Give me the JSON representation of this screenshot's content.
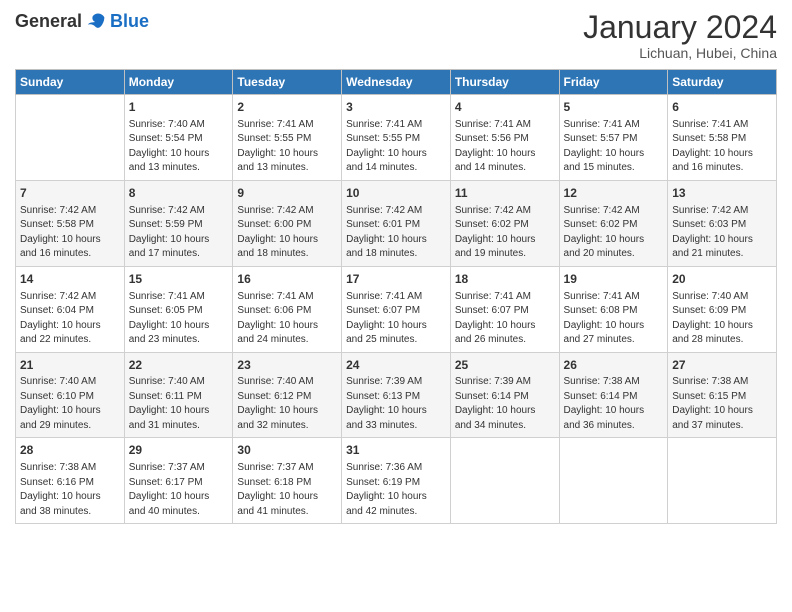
{
  "header": {
    "logo_general": "General",
    "logo_blue": "Blue",
    "title": "January 2024",
    "subtitle": "Lichuan, Hubei, China"
  },
  "days_of_week": [
    "Sunday",
    "Monday",
    "Tuesday",
    "Wednesday",
    "Thursday",
    "Friday",
    "Saturday"
  ],
  "weeks": [
    [
      {
        "day": "",
        "sunrise": "",
        "sunset": "",
        "daylight": ""
      },
      {
        "day": "1",
        "sunrise": "Sunrise: 7:40 AM",
        "sunset": "Sunset: 5:54 PM",
        "daylight": "Daylight: 10 hours and 13 minutes."
      },
      {
        "day": "2",
        "sunrise": "Sunrise: 7:41 AM",
        "sunset": "Sunset: 5:55 PM",
        "daylight": "Daylight: 10 hours and 13 minutes."
      },
      {
        "day": "3",
        "sunrise": "Sunrise: 7:41 AM",
        "sunset": "Sunset: 5:55 PM",
        "daylight": "Daylight: 10 hours and 14 minutes."
      },
      {
        "day": "4",
        "sunrise": "Sunrise: 7:41 AM",
        "sunset": "Sunset: 5:56 PM",
        "daylight": "Daylight: 10 hours and 14 minutes."
      },
      {
        "day": "5",
        "sunrise": "Sunrise: 7:41 AM",
        "sunset": "Sunset: 5:57 PM",
        "daylight": "Daylight: 10 hours and 15 minutes."
      },
      {
        "day": "6",
        "sunrise": "Sunrise: 7:41 AM",
        "sunset": "Sunset: 5:58 PM",
        "daylight": "Daylight: 10 hours and 16 minutes."
      }
    ],
    [
      {
        "day": "7",
        "sunrise": "Sunrise: 7:42 AM",
        "sunset": "Sunset: 5:58 PM",
        "daylight": "Daylight: 10 hours and 16 minutes."
      },
      {
        "day": "8",
        "sunrise": "Sunrise: 7:42 AM",
        "sunset": "Sunset: 5:59 PM",
        "daylight": "Daylight: 10 hours and 17 minutes."
      },
      {
        "day": "9",
        "sunrise": "Sunrise: 7:42 AM",
        "sunset": "Sunset: 6:00 PM",
        "daylight": "Daylight: 10 hours and 18 minutes."
      },
      {
        "day": "10",
        "sunrise": "Sunrise: 7:42 AM",
        "sunset": "Sunset: 6:01 PM",
        "daylight": "Daylight: 10 hours and 18 minutes."
      },
      {
        "day": "11",
        "sunrise": "Sunrise: 7:42 AM",
        "sunset": "Sunset: 6:02 PM",
        "daylight": "Daylight: 10 hours and 19 minutes."
      },
      {
        "day": "12",
        "sunrise": "Sunrise: 7:42 AM",
        "sunset": "Sunset: 6:02 PM",
        "daylight": "Daylight: 10 hours and 20 minutes."
      },
      {
        "day": "13",
        "sunrise": "Sunrise: 7:42 AM",
        "sunset": "Sunset: 6:03 PM",
        "daylight": "Daylight: 10 hours and 21 minutes."
      }
    ],
    [
      {
        "day": "14",
        "sunrise": "Sunrise: 7:42 AM",
        "sunset": "Sunset: 6:04 PM",
        "daylight": "Daylight: 10 hours and 22 minutes."
      },
      {
        "day": "15",
        "sunrise": "Sunrise: 7:41 AM",
        "sunset": "Sunset: 6:05 PM",
        "daylight": "Daylight: 10 hours and 23 minutes."
      },
      {
        "day": "16",
        "sunrise": "Sunrise: 7:41 AM",
        "sunset": "Sunset: 6:06 PM",
        "daylight": "Daylight: 10 hours and 24 minutes."
      },
      {
        "day": "17",
        "sunrise": "Sunrise: 7:41 AM",
        "sunset": "Sunset: 6:07 PM",
        "daylight": "Daylight: 10 hours and 25 minutes."
      },
      {
        "day": "18",
        "sunrise": "Sunrise: 7:41 AM",
        "sunset": "Sunset: 6:07 PM",
        "daylight": "Daylight: 10 hours and 26 minutes."
      },
      {
        "day": "19",
        "sunrise": "Sunrise: 7:41 AM",
        "sunset": "Sunset: 6:08 PM",
        "daylight": "Daylight: 10 hours and 27 minutes."
      },
      {
        "day": "20",
        "sunrise": "Sunrise: 7:40 AM",
        "sunset": "Sunset: 6:09 PM",
        "daylight": "Daylight: 10 hours and 28 minutes."
      }
    ],
    [
      {
        "day": "21",
        "sunrise": "Sunrise: 7:40 AM",
        "sunset": "Sunset: 6:10 PM",
        "daylight": "Daylight: 10 hours and 29 minutes."
      },
      {
        "day": "22",
        "sunrise": "Sunrise: 7:40 AM",
        "sunset": "Sunset: 6:11 PM",
        "daylight": "Daylight: 10 hours and 31 minutes."
      },
      {
        "day": "23",
        "sunrise": "Sunrise: 7:40 AM",
        "sunset": "Sunset: 6:12 PM",
        "daylight": "Daylight: 10 hours and 32 minutes."
      },
      {
        "day": "24",
        "sunrise": "Sunrise: 7:39 AM",
        "sunset": "Sunset: 6:13 PM",
        "daylight": "Daylight: 10 hours and 33 minutes."
      },
      {
        "day": "25",
        "sunrise": "Sunrise: 7:39 AM",
        "sunset": "Sunset: 6:14 PM",
        "daylight": "Daylight: 10 hours and 34 minutes."
      },
      {
        "day": "26",
        "sunrise": "Sunrise: 7:38 AM",
        "sunset": "Sunset: 6:14 PM",
        "daylight": "Daylight: 10 hours and 36 minutes."
      },
      {
        "day": "27",
        "sunrise": "Sunrise: 7:38 AM",
        "sunset": "Sunset: 6:15 PM",
        "daylight": "Daylight: 10 hours and 37 minutes."
      }
    ],
    [
      {
        "day": "28",
        "sunrise": "Sunrise: 7:38 AM",
        "sunset": "Sunset: 6:16 PM",
        "daylight": "Daylight: 10 hours and 38 minutes."
      },
      {
        "day": "29",
        "sunrise": "Sunrise: 7:37 AM",
        "sunset": "Sunset: 6:17 PM",
        "daylight": "Daylight: 10 hours and 40 minutes."
      },
      {
        "day": "30",
        "sunrise": "Sunrise: 7:37 AM",
        "sunset": "Sunset: 6:18 PM",
        "daylight": "Daylight: 10 hours and 41 minutes."
      },
      {
        "day": "31",
        "sunrise": "Sunrise: 7:36 AM",
        "sunset": "Sunset: 6:19 PM",
        "daylight": "Daylight: 10 hours and 42 minutes."
      },
      {
        "day": "",
        "sunrise": "",
        "sunset": "",
        "daylight": ""
      },
      {
        "day": "",
        "sunrise": "",
        "sunset": "",
        "daylight": ""
      },
      {
        "day": "",
        "sunrise": "",
        "sunset": "",
        "daylight": ""
      }
    ]
  ]
}
